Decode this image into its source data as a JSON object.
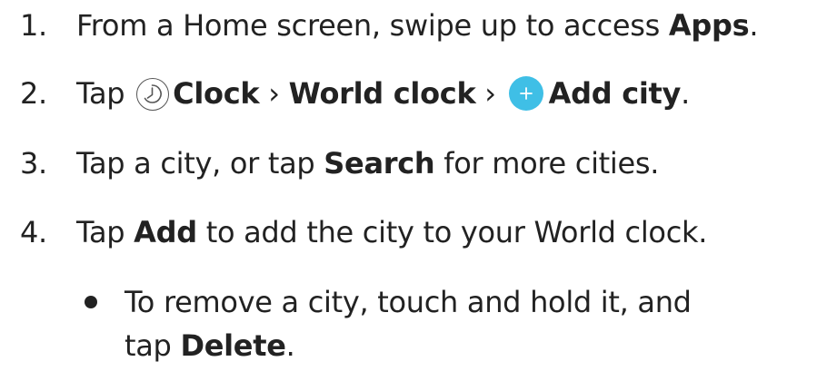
{
  "steps": [
    {
      "number": "1.",
      "text_a": "From a Home screen, swipe up to access ",
      "bold_a": "Apps",
      "text_b": "."
    },
    {
      "number": "2.",
      "text_a": "Tap",
      "icon_a": "clock-icon",
      "bold_a": "Clock",
      "sep_a": "›",
      "bold_b": "World clock",
      "sep_b": "›",
      "icon_b": "add-icon",
      "bold_c": "Add city",
      "text_b": "."
    },
    {
      "number": "3.",
      "text_a": "Tap a city, or tap ",
      "bold_a": "Search",
      "text_b": " for more cities."
    },
    {
      "number": "4.",
      "text_a": "Tap ",
      "bold_a": "Add",
      "text_b": " to add the city to your World clock."
    }
  ],
  "bullet": {
    "line1": "To remove a city, touch and hold it, and",
    "line2_a": "tap ",
    "line2_bold": "Delete",
    "line2_b": "."
  },
  "colors": {
    "text": "#222222",
    "add_icon": "#3fbfe6"
  }
}
